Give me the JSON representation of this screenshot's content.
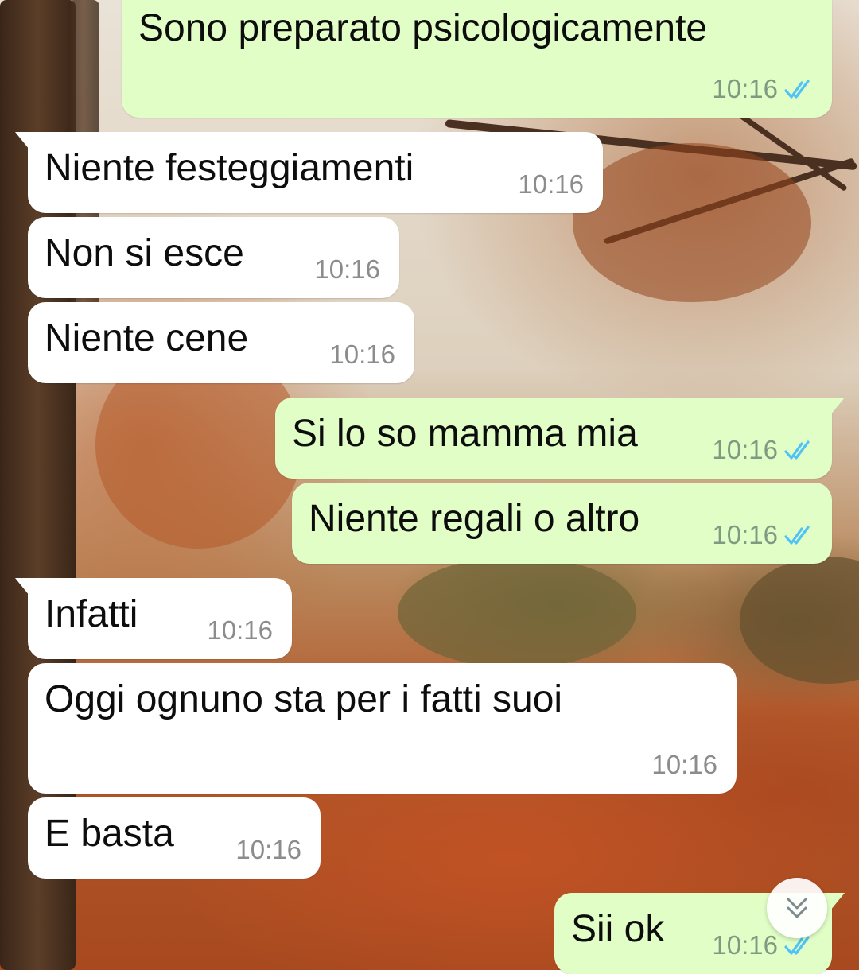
{
  "conversation": {
    "messages": [
      {
        "id": "m1",
        "direction": "out",
        "text": "Sono preparato psicologicamente",
        "time": "10:16",
        "status": "read"
      },
      {
        "id": "m2",
        "direction": "in",
        "text": "Niente festeggiamenti",
        "time": "10:16"
      },
      {
        "id": "m3",
        "direction": "in",
        "text": "Non si esce",
        "time": "10:16"
      },
      {
        "id": "m4",
        "direction": "in",
        "text": "Niente cene",
        "time": "10:16"
      },
      {
        "id": "m5",
        "direction": "out",
        "text": "Si lo so mamma mia",
        "time": "10:16",
        "status": "read"
      },
      {
        "id": "m6",
        "direction": "out",
        "text": "Niente regali o altro",
        "time": "10:16",
        "status": "read"
      },
      {
        "id": "m7",
        "direction": "in",
        "text": "Infatti",
        "time": "10:16"
      },
      {
        "id": "m8",
        "direction": "in",
        "text": "Oggi ognuno sta per i fatti suoi",
        "time": "10:16"
      },
      {
        "id": "m9",
        "direction": "in",
        "text": "E basta",
        "time": "10:16"
      },
      {
        "id": "m10",
        "direction": "out",
        "text": "Sii ok",
        "time": "10:16",
        "status": "read"
      }
    ]
  },
  "controls": {
    "scroll_down_icon": "double-chevron-down-icon"
  },
  "colors": {
    "incoming_bubble": "#ffffff",
    "outgoing_bubble": "#e1fec6",
    "read_ticks": "#4fc3f7"
  }
}
